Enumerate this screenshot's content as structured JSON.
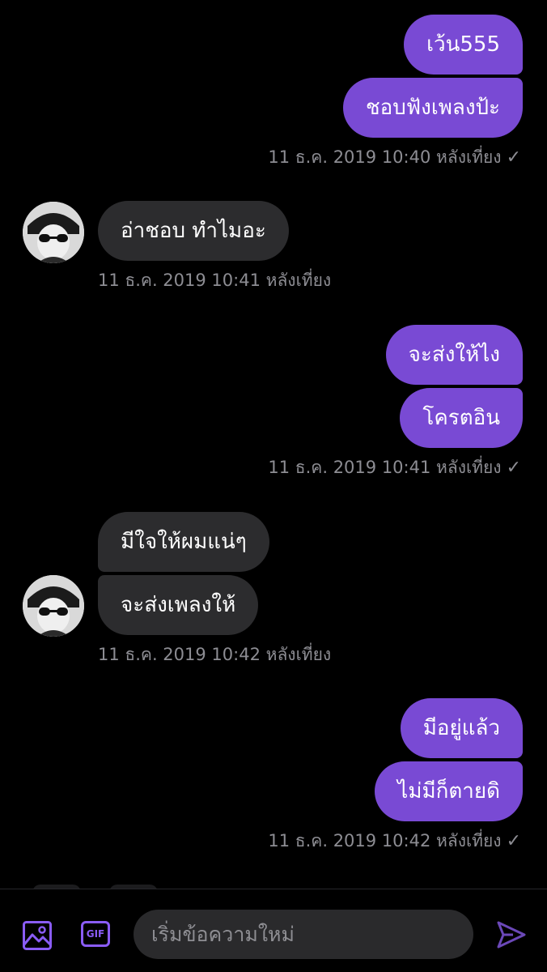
{
  "messages": {
    "m1": "เว้น555",
    "m2": "ชอบฟังเพลงป้ะ",
    "m3": "อ่าชอบ ทำไมอะ",
    "m4": "จะส่งให้ไง",
    "m5": "โครตอิน",
    "m6": "มีใจให้ผมแน่ๆ",
    "m7": "จะส่งเพลงให้",
    "m8": "มีอยู่แล้ว",
    "m9": "ไม่มีก็ตายดิ"
  },
  "timestamps": {
    "t1": "11 ธ.ค. 2019 10:40 หลังเที่ยง",
    "t2": "11 ธ.ค. 2019 10:41 หลังเที่ยง",
    "t3": "11 ธ.ค. 2019 10:41 หลังเที่ยง",
    "t4": "11 ธ.ค. 2019 10:42 หลังเที่ยง",
    "t5": "11 ธ.ค. 2019 10:42 หลังเที่ยง"
  },
  "read_receipt": "✓",
  "composer": {
    "gif_label": "GIF",
    "placeholder": "เริ่มข้อความใหม่"
  },
  "icons": {
    "image": "image-icon",
    "gif": "gif-icon",
    "send": "send-icon"
  },
  "colors": {
    "sent_bubble": "#794ad4",
    "received_bubble": "#2c2c2e",
    "accent": "#8a5cf6",
    "background": "#000000",
    "timestamp": "#8d8d93"
  }
}
